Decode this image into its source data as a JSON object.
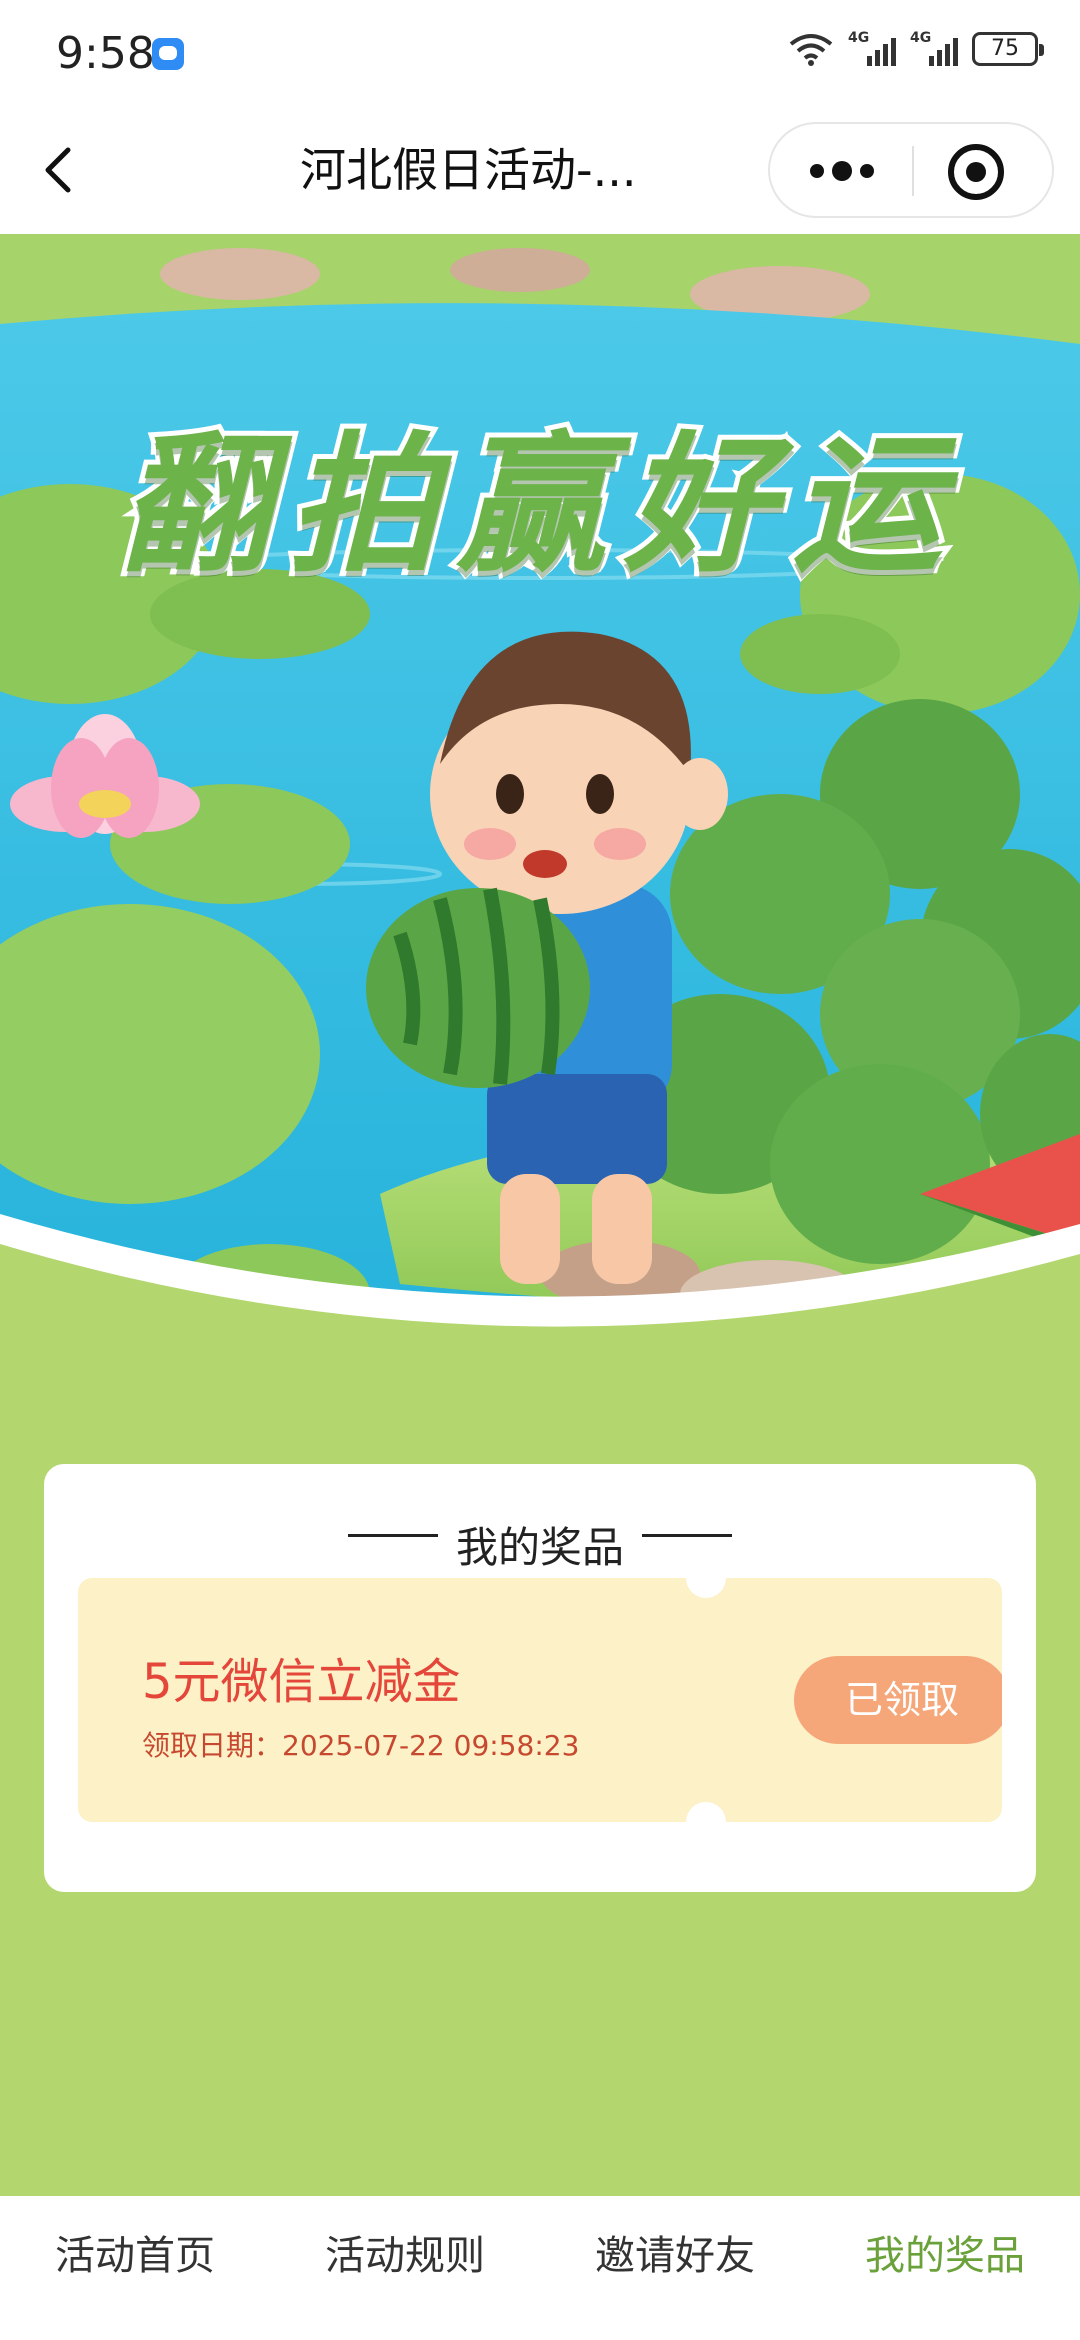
{
  "status_bar": {
    "time": "9:58",
    "network_1": "4G",
    "network_2": "4G",
    "battery": "75"
  },
  "nav": {
    "title": "河北假日活动-...",
    "icons": [
      "back-arrow-icon",
      "more-dots-icon",
      "target-icon"
    ]
  },
  "banner": {
    "title": "翻拍赢好运"
  },
  "prizes": {
    "heading": "我的奖品",
    "items": [
      {
        "name": "5元微信立减金",
        "date": "领取日期：2025-07-22 09:58:23",
        "button_label": "已领取"
      }
    ]
  },
  "tabs": [
    {
      "label": "活动首页",
      "active": false
    },
    {
      "label": "活动规则",
      "active": false
    },
    {
      "label": "邀请好友",
      "active": false
    },
    {
      "label": "我的奖品",
      "active": true
    }
  ],
  "colors": {
    "page_background": "#b3d66e",
    "active_tab": "#6aa13a",
    "coupon_background": "#fdf1c8",
    "coupon_text": "#e4473a",
    "claimed_button": "#f6a77a",
    "banner_title": "#6cb34a"
  }
}
